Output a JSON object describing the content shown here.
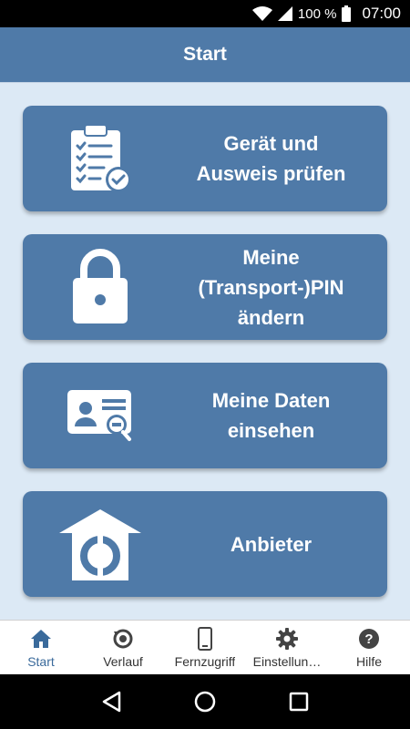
{
  "status_bar": {
    "battery_percent": "100 %",
    "time": "07:00"
  },
  "app_bar": {
    "title": "Start"
  },
  "tiles": [
    {
      "label": "Gerät und\nAusweis prüfen",
      "icon": "checklist-icon"
    },
    {
      "label": "Meine\n(Transport-)PIN\nändern",
      "icon": "lock-icon"
    },
    {
      "label": "Meine Daten\neinsehen",
      "icon": "id-card-search-icon"
    },
    {
      "label": "Anbieter",
      "icon": "provider-house-icon"
    }
  ],
  "bottom_nav": [
    {
      "label": "Start",
      "icon": "home-icon",
      "active": true
    },
    {
      "label": "Verlauf",
      "icon": "history-icon",
      "active": false
    },
    {
      "label": "Fernzugriff",
      "icon": "smartphone-icon",
      "active": false
    },
    {
      "label": "Einstellun…",
      "icon": "gear-icon",
      "active": false
    },
    {
      "label": "Hilfe",
      "icon": "help-icon",
      "active": false
    }
  ],
  "colors": {
    "accent": "#4f7aa8",
    "background": "#dce9f5",
    "active_nav": "#3a6a9b"
  }
}
